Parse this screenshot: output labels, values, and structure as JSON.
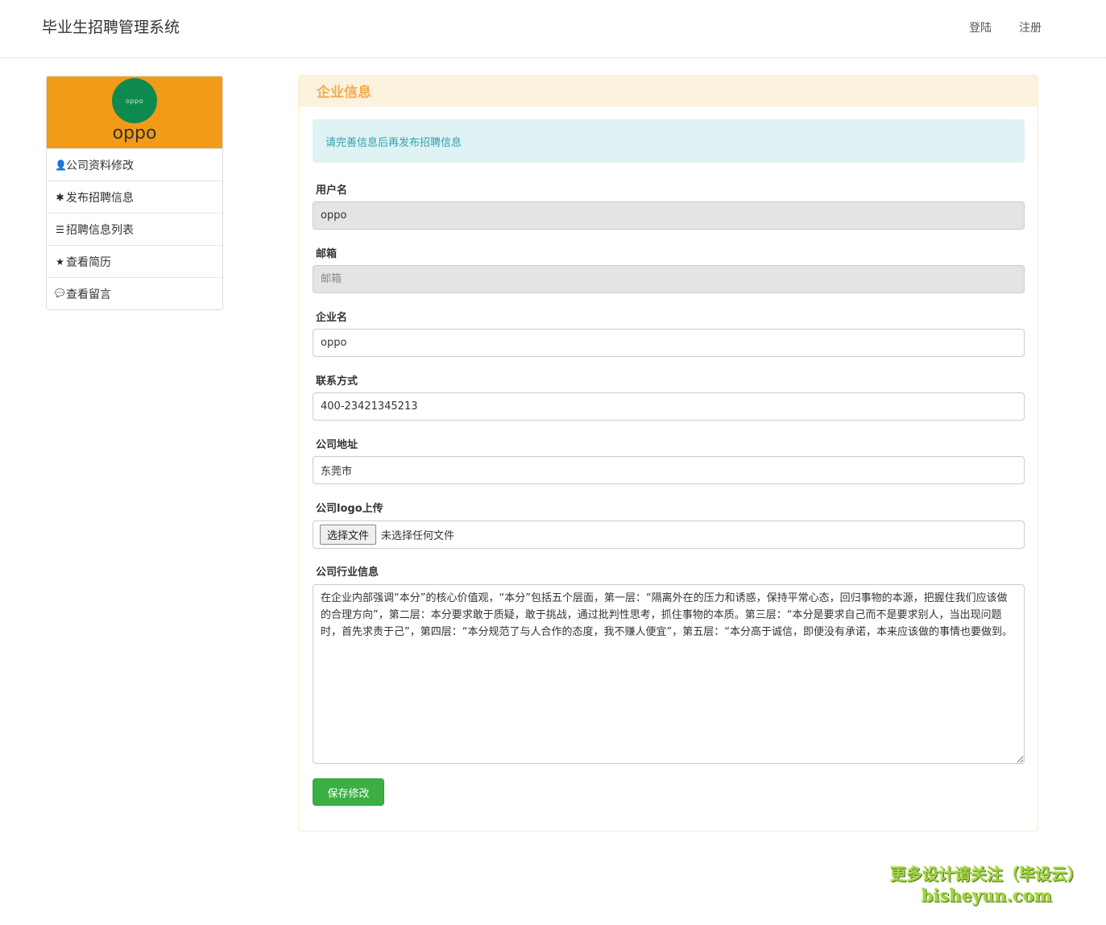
{
  "header": {
    "title": "毕业生招聘管理系统",
    "login": "登陆",
    "register": "注册"
  },
  "sidebar": {
    "logo_text": "oppo",
    "company_name": "oppo",
    "items": [
      {
        "label": "公司资料修改",
        "icon": "user-icon",
        "glyph": "👤"
      },
      {
        "label": "发布招聘信息",
        "icon": "asterisk-icon",
        "glyph": "✱"
      },
      {
        "label": "招聘信息列表",
        "icon": "list-icon",
        "glyph": "☰"
      },
      {
        "label": "查看简历",
        "icon": "star-icon",
        "glyph": "★"
      },
      {
        "label": "查看留言",
        "icon": "comment-icon",
        "glyph": "💬"
      }
    ]
  },
  "panel": {
    "title": "企业信息",
    "alert": "请完善信息后再发布招聘信息"
  },
  "form": {
    "username": {
      "label": "用户名",
      "value": "oppo"
    },
    "email": {
      "label": "邮箱",
      "value": "",
      "placeholder": "邮箱"
    },
    "company": {
      "label": "企业名",
      "value": "oppo"
    },
    "contact": {
      "label": "联系方式",
      "value": "400-23421345213"
    },
    "address": {
      "label": "公司地址",
      "value": "东莞市"
    },
    "logo": {
      "label": "公司logo上传",
      "button": "选择文件",
      "status": "未选择任何文件"
    },
    "industry": {
      "label": "公司行业信息",
      "value": "在企业内部强调“本分”的核心价值观，“本分”包括五个层面，第一层：“隔离外在的压力和诱惑，保持平常心态，回归事物的本源，把握住我们应该做的合理方向”，第二层：本分要求敢于质疑，敢于挑战，通过批判性思考，抓住事物的本质。第三层：“本分是要求自己而不是要求别人，当出现问题时，首先求责于己”，第四层：“本分规范了与人合作的态度，我不赚人便宜”，第五层：“本分高于诚信，即便没有承诺，本来应该做的事情也要做到。"
    },
    "save": "保存修改"
  },
  "watermark": {
    "line1": "更多设计请关注（毕设云）",
    "line2": "bisheyun.com"
  },
  "colors": {
    "profile_bg": "#f29b18",
    "logo_bg": "#0f8a4f",
    "panel_heading_bg": "#fcf2dd",
    "panel_title": "#f0ad4e",
    "alert_bg": "#dff2f4",
    "save_button": "#3caf42"
  }
}
